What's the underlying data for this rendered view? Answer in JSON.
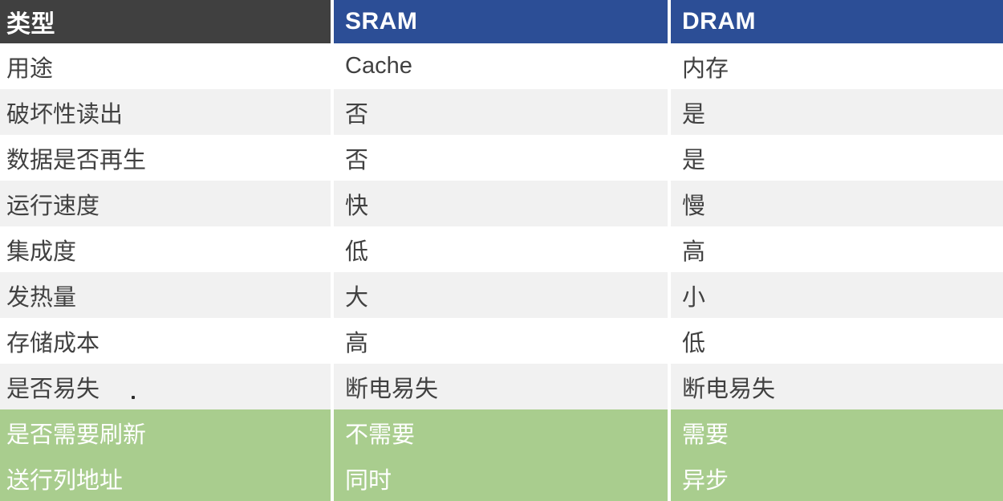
{
  "table": {
    "columns": [
      "类型",
      "SRAM",
      "DRAM"
    ],
    "header_colors": {
      "type_bg": "#404040",
      "sram_bg": "#2C4E96",
      "dram_bg": "#2C4E96",
      "text": "#ffffff"
    },
    "row_colors": {
      "odd_bg": "#ffffff",
      "even_bg": "#F1F1F1",
      "highlight_bg": "#A9CD8E",
      "body_text": "#414141",
      "highlight_text": "#ffffff"
    },
    "rows": [
      {
        "label": "用途",
        "sram": "Cache",
        "dram": "内存",
        "style": "white"
      },
      {
        "label": "破坏性读出",
        "sram": "否",
        "dram": "是",
        "style": "gray"
      },
      {
        "label": "数据是否再生",
        "sram": "否",
        "dram": "是",
        "style": "white"
      },
      {
        "label": "运行速度",
        "sram": "快",
        "dram": "慢",
        "style": "gray"
      },
      {
        "label": "集成度",
        "sram": "低",
        "dram": "高",
        "style": "white"
      },
      {
        "label": "发热量",
        "sram": "大",
        "dram": "小",
        "style": "gray"
      },
      {
        "label": "存储成本",
        "sram": "高",
        "dram": "低",
        "style": "white"
      },
      {
        "label": "是否易失",
        "sram": "断电易失",
        "dram": "断电易失",
        "style": "gray",
        "stray_dot": true
      },
      {
        "label": "是否需要刷新",
        "sram": "不需要",
        "dram": "需要",
        "style": "green"
      },
      {
        "label": "送行列地址",
        "sram": "同时",
        "dram": "异步",
        "style": "green"
      }
    ]
  }
}
